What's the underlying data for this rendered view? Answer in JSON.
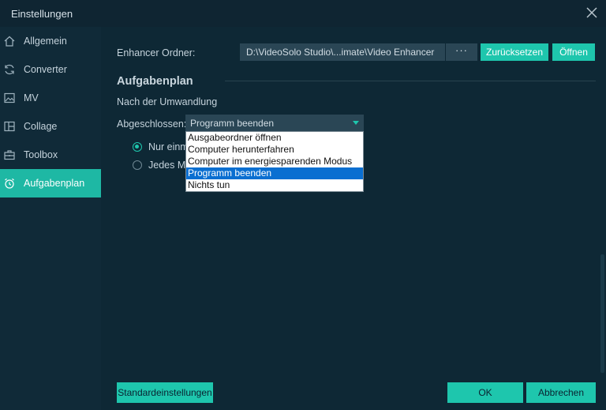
{
  "window": {
    "title": "Einstellungen"
  },
  "sidebar": {
    "items": [
      {
        "label": "Allgemein",
        "icon": "home-icon",
        "active": false
      },
      {
        "label": "Converter",
        "icon": "refresh-icon",
        "active": false
      },
      {
        "label": "MV",
        "icon": "image-icon",
        "active": false
      },
      {
        "label": "Collage",
        "icon": "collage-icon",
        "active": false
      },
      {
        "label": "Toolbox",
        "icon": "toolbox-icon",
        "active": false
      },
      {
        "label": "Aufgabenplan",
        "icon": "alarm-clock-icon",
        "active": true
      }
    ]
  },
  "enhancer": {
    "label": "Enhancer Ordner:",
    "path": "D:\\VideoSolo Studio\\...imate\\Video Enhancer",
    "dots": "···",
    "reset_label": "Zurücksetzen",
    "open_label": "Öffnen"
  },
  "taskplan": {
    "title": "Aufgabenplan",
    "subtitle": "Nach der Umwandlung",
    "completed_label": "Abgeschlossen:",
    "selected_value": "Programm beenden",
    "options": [
      "Ausgabeordner öffnen",
      "Computer herunterfahren",
      "Computer im energiesparenden Modus",
      "Programm beenden",
      "Nichts tun"
    ],
    "selected_index": 3,
    "radio_once": "Nur einm",
    "radio_every": "Jedes Ma"
  },
  "footer": {
    "defaults_label": "Standardeinstellungen",
    "ok_label": "OK",
    "cancel_label": "Abbrechen"
  },
  "colors": {
    "accent": "#1ec6ad",
    "sidebar_active": "#1eb8a4",
    "background": "#0e2835",
    "dropdown_highlight": "#0a6fd1"
  }
}
